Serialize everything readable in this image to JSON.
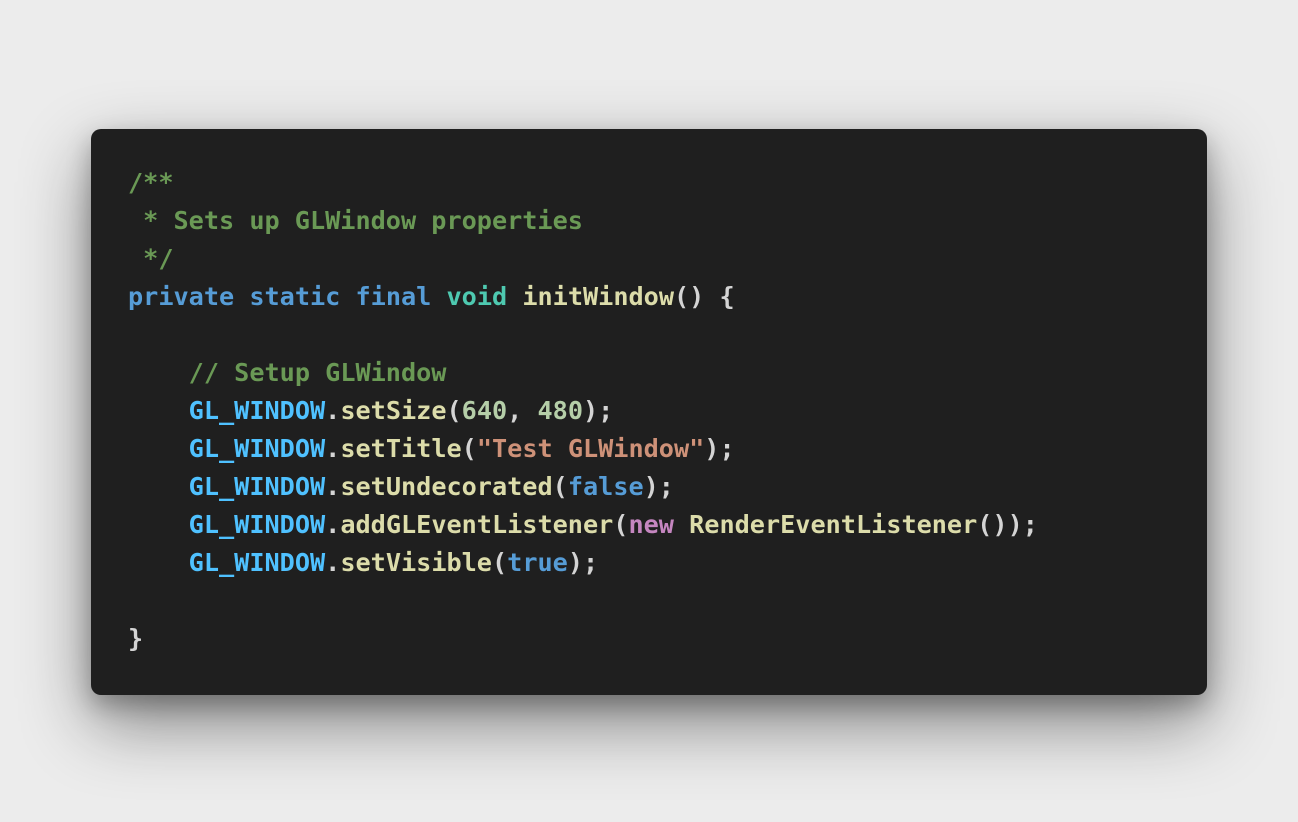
{
  "colors": {
    "background": "#ececec",
    "editor_background": "#1f1f1f",
    "comment": "#6a9955",
    "keyword": "#569cd6",
    "type": "#4ec9b0",
    "function": "#dcdcaa",
    "variable": "#4fc1ff",
    "number": "#b5cea8",
    "string": "#ce9178",
    "control_keyword": "#c586c0",
    "punctuation": "#d4d4d4"
  },
  "code": {
    "lines": [
      [
        {
          "t": "comment",
          "v": "/**"
        }
      ],
      [
        {
          "t": "comment",
          "v": " * Sets up GLWindow properties"
        }
      ],
      [
        {
          "t": "comment",
          "v": " */"
        }
      ],
      [
        {
          "t": "keyword",
          "v": "private"
        },
        {
          "t": "punct",
          "v": " "
        },
        {
          "t": "keyword",
          "v": "static"
        },
        {
          "t": "punct",
          "v": " "
        },
        {
          "t": "keyword",
          "v": "final"
        },
        {
          "t": "punct",
          "v": " "
        },
        {
          "t": "type",
          "v": "void"
        },
        {
          "t": "punct",
          "v": " "
        },
        {
          "t": "func",
          "v": "initWindow"
        },
        {
          "t": "punct",
          "v": "() {"
        }
      ],
      [],
      [
        {
          "t": "punct",
          "v": "    "
        },
        {
          "t": "comment",
          "v": "// Setup GLWindow"
        }
      ],
      [
        {
          "t": "punct",
          "v": "    "
        },
        {
          "t": "var",
          "v": "GL_WINDOW"
        },
        {
          "t": "punct",
          "v": "."
        },
        {
          "t": "func",
          "v": "setSize"
        },
        {
          "t": "punct",
          "v": "("
        },
        {
          "t": "number",
          "v": "640"
        },
        {
          "t": "punct",
          "v": ", "
        },
        {
          "t": "number",
          "v": "480"
        },
        {
          "t": "punct",
          "v": ");"
        }
      ],
      [
        {
          "t": "punct",
          "v": "    "
        },
        {
          "t": "var",
          "v": "GL_WINDOW"
        },
        {
          "t": "punct",
          "v": "."
        },
        {
          "t": "func",
          "v": "setTitle"
        },
        {
          "t": "punct",
          "v": "("
        },
        {
          "t": "string",
          "v": "\"Test GLWindow\""
        },
        {
          "t": "punct",
          "v": ");"
        }
      ],
      [
        {
          "t": "punct",
          "v": "    "
        },
        {
          "t": "var",
          "v": "GL_WINDOW"
        },
        {
          "t": "punct",
          "v": "."
        },
        {
          "t": "func",
          "v": "setUndecorated"
        },
        {
          "t": "punct",
          "v": "("
        },
        {
          "t": "keyword",
          "v": "false"
        },
        {
          "t": "punct",
          "v": ");"
        }
      ],
      [
        {
          "t": "punct",
          "v": "    "
        },
        {
          "t": "var",
          "v": "GL_WINDOW"
        },
        {
          "t": "punct",
          "v": "."
        },
        {
          "t": "func",
          "v": "addGLEventListener"
        },
        {
          "t": "punct",
          "v": "("
        },
        {
          "t": "control",
          "v": "new"
        },
        {
          "t": "punct",
          "v": " "
        },
        {
          "t": "func",
          "v": "RenderEventListener"
        },
        {
          "t": "punct",
          "v": "());"
        }
      ],
      [
        {
          "t": "punct",
          "v": "    "
        },
        {
          "t": "var",
          "v": "GL_WINDOW"
        },
        {
          "t": "punct",
          "v": "."
        },
        {
          "t": "func",
          "v": "setVisible"
        },
        {
          "t": "punct",
          "v": "("
        },
        {
          "t": "keyword",
          "v": "true"
        },
        {
          "t": "punct",
          "v": ");"
        }
      ],
      [],
      [
        {
          "t": "punct",
          "v": "}"
        }
      ]
    ]
  }
}
